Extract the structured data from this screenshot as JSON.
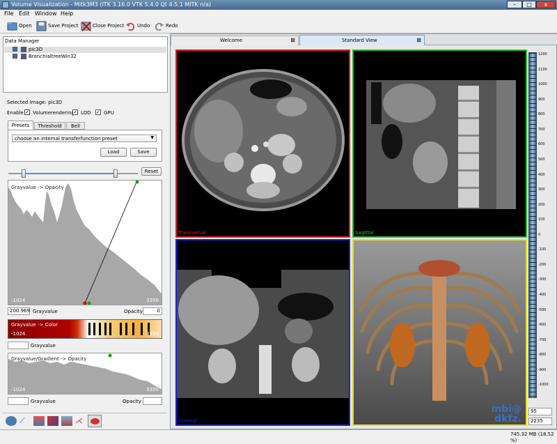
{
  "window": {
    "title": "Volume Visualization - Mitk3M3 (ITK 3.16.0  VTK 5.4.0 Qt 4.5.1 MITK n/a)",
    "minimize": "–",
    "maximize": "□",
    "close": "x"
  },
  "menu": {
    "file": "File",
    "edit": "Edit",
    "window": "Window",
    "help": "Help"
  },
  "toolbar": {
    "open": "Open",
    "save_project": "Save Project",
    "close_project": "Close Project",
    "undo": "Undo",
    "redo": "Redo"
  },
  "data_manager": {
    "title": "Data Manager",
    "items": [
      {
        "label": "pic3D"
      },
      {
        "label": "BronchialtreeWin32"
      }
    ]
  },
  "volume_panel": {
    "selected_image": "Selected Image: pic3D",
    "enable": "Enable",
    "volumerendering": "Volumerendering",
    "lod": "LOD",
    "gpu": "GPU",
    "tabs": [
      "Presets",
      "Threshold",
      "Bell"
    ],
    "preset_value": "choose an internal transferfunction preset",
    "load": "Load",
    "save": "Save",
    "reset": "Reset",
    "opacity_graph_title": "Grayvalue -> Opacity",
    "graph_min": "-1024",
    "graph_max": "3350",
    "grayvalue_value": "200.969",
    "grayvalue_label": "Grayvalue",
    "opacity_label": "Opacity",
    "opacity_value": "0",
    "color_title": "Grayvalue -> Color",
    "color_min": "-1024",
    "color_max": "3350",
    "grayvalue_label2": "Grayvalue",
    "gradient_title": "Grayvalue/Gradient -> Opacity",
    "gradient_min": "-1024",
    "gradient_max": "3350",
    "grayvalue_label3": "Grayvalue",
    "opacity_label3": "Opacity",
    "slider_fraction_low": 0.12,
    "slider_fraction_high": 0.83
  },
  "tabs": {
    "welcome": "Welcome",
    "standard_view": "Standard View"
  },
  "views": {
    "transversal": "Transversal",
    "sagittal": "Sagittal",
    "coronal": "Coronal",
    "logo_line1": "mbi@",
    "logo_line2": "dkfz."
  },
  "level_window": {
    "ticks": [
      "1200",
      "1100",
      "1000",
      "900",
      "800",
      "700",
      "600",
      "500",
      "400",
      "300",
      "200",
      "100",
      "0",
      "-100",
      "-200",
      "-300",
      "-400",
      "-500",
      "-600",
      "-700",
      "-800",
      "-900",
      "-1000"
    ],
    "level": "95",
    "window": "2235"
  },
  "status": {
    "memory": "745.32 MB (18.52 %)"
  },
  "colors": {
    "transversal": "#e02020",
    "sagittal": "#20c020",
    "coronal": "#2020e0",
    "three_d": "#e0e020",
    "accent": "#4a78b0"
  }
}
